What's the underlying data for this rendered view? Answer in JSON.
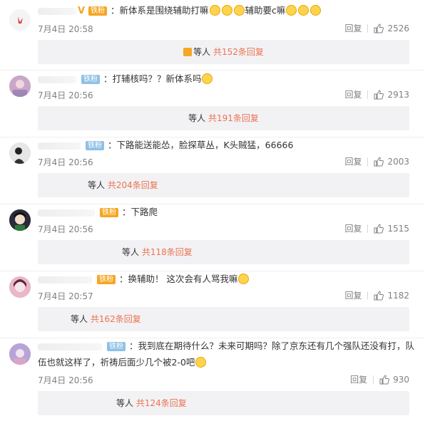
{
  "comments": [
    {
      "badge": "铁粉",
      "content": "：新体系是围绕辅助打嘛",
      "content2": "辅助要c嘛",
      "time": "7月4日 20:58",
      "reply": "回复",
      "likes": "2526",
      "sub_prefix": "等人",
      "sub_more": "共152条回复",
      "avatar_color": "#f4f4f4"
    },
    {
      "badge": "铁粉",
      "content": "：打辅核吗？？新体系吗",
      "time": "7月4日 20:56",
      "reply": "回复",
      "likes": "2913",
      "sub_prefix": "等人",
      "sub_more": "共191条回复",
      "avatar_color": "#c9a7c8"
    },
    {
      "badge": "铁粉",
      "content": "：下路能送能怂，脸探草丛，K头贼猛，66666",
      "time": "7月4日 20:56",
      "reply": "回复",
      "likes": "2003",
      "sub_prefix": "等人",
      "sub_more": "共204条回复",
      "avatar_color": "#d8d8d8"
    },
    {
      "badge": "铁粉",
      "content": "：下路爬",
      "time": "7月4日 20:56",
      "reply": "回复",
      "likes": "1515",
      "sub_prefix": "等人",
      "sub_more": "共118条回复",
      "avatar_color": "#2a2a3a"
    },
    {
      "badge": "铁粉",
      "content": "：换辅助！ 这次会有人骂我嘛",
      "time": "7月4日 20:57",
      "reply": "回复",
      "likes": "1182",
      "sub_prefix": "等人",
      "sub_more": "共162条回复",
      "avatar_color": "#e9b7c6"
    },
    {
      "badge": "铁粉",
      "content": "：我到底在期待什么？未来可期吗？除了京东还有几个强队还没有打，队",
      "content2": "伍也就这样了，祈祷后面少几个被2-0吧",
      "time": "7月4日 20:56",
      "reply": "回复",
      "likes": "930",
      "sub_prefix": "等人",
      "sub_more": "共124条回复",
      "avatar_color": "#b7a4d6"
    }
  ]
}
